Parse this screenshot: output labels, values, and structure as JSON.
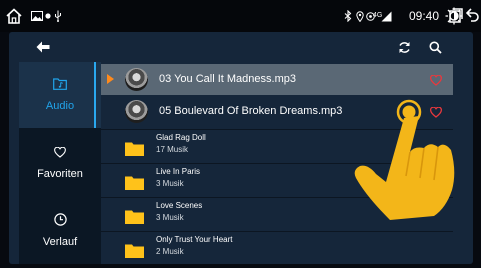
{
  "status_bar": {
    "icons": [
      "home-icon",
      "gallery-icon",
      "dot-icon",
      "usb-icon",
      "bluetooth-icon",
      "location-icon",
      "hotspot-icon",
      "signal-icon",
      "brightness-icon",
      "recent-apps-icon",
      "back-icon"
    ],
    "network": "4G",
    "time": "09:40"
  },
  "toolbar": {
    "back": "back-arrow-icon",
    "actions": [
      "repeat-icon",
      "search-icon"
    ]
  },
  "sidebar": {
    "items": [
      {
        "label": "Audio",
        "icon": "music-folder-icon",
        "active": true
      },
      {
        "label": "Favoriten",
        "icon": "heart-outline-icon",
        "active": false
      },
      {
        "label": "Verlauf",
        "icon": "clock-icon",
        "active": false
      }
    ]
  },
  "tracks": [
    {
      "title": "03 You Call It Madness.mp3",
      "playing": true
    },
    {
      "title": "05 Boulevard Of Broken Dreams.mp3",
      "playing": false
    }
  ],
  "folders": [
    {
      "name": "Glad Rag Doll",
      "count": "17 Musik"
    },
    {
      "name": "Live In Paris",
      "count": "3 Musik"
    },
    {
      "name": "Love Scenes",
      "count": "3 Musik"
    },
    {
      "name": "Only Trust Your Heart",
      "count": "2 Musik"
    }
  ],
  "colors": {
    "accent": "#21a4ea",
    "play_indicator": "#ff8a1c",
    "heart": "#e8383d",
    "folder": "#ffc21a",
    "hand": "#f3b619"
  }
}
